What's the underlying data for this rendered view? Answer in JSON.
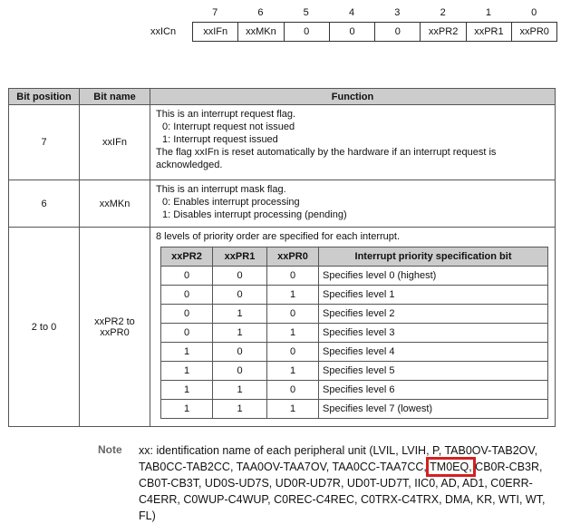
{
  "register": {
    "name": "xxICn",
    "bit_numbers": [
      "7",
      "6",
      "5",
      "4",
      "3",
      "2",
      "1",
      "0"
    ],
    "bits": [
      "xxIFn",
      "xxMKn",
      "0",
      "0",
      "0",
      "xxPR2",
      "xxPR1",
      "xxPR0"
    ]
  },
  "table": {
    "headers": [
      "Bit position",
      "Bit name",
      "Function"
    ],
    "rows": [
      {
        "position": "7",
        "name": "xxIFn",
        "lines": [
          "This is an interrupt request flag.",
          "0: Interrupt request not issued",
          "1: Interrupt request issued",
          "The flag xxIFn is reset automatically by the hardware if an interrupt request is acknowledged."
        ]
      },
      {
        "position": "6",
        "name": "xxMKn",
        "lines": [
          "This is an interrupt mask flag.",
          "0: Enables interrupt processing",
          "1: Disables interrupt processing (pending)"
        ]
      },
      {
        "position": "2 to 0",
        "name": "xxPR2 to xxPR0",
        "intro": "8 levels of priority order are specified for each interrupt."
      }
    ],
    "priority": {
      "headers": [
        "xxPR2",
        "xxPR1",
        "xxPR0",
        "Interrupt priority specification bit"
      ],
      "rows": [
        [
          "0",
          "0",
          "0",
          "Specifies level 0 (highest)"
        ],
        [
          "0",
          "0",
          "1",
          "Specifies level 1"
        ],
        [
          "0",
          "1",
          "0",
          "Specifies level 2"
        ],
        [
          "0",
          "1",
          "1",
          "Specifies level 3"
        ],
        [
          "1",
          "0",
          "0",
          "Specifies level 4"
        ],
        [
          "1",
          "0",
          "1",
          "Specifies level 5"
        ],
        [
          "1",
          "1",
          "0",
          "Specifies level 6"
        ],
        [
          "1",
          "1",
          "1",
          "Specifies level 7 (lowest)"
        ]
      ]
    }
  },
  "note": {
    "label": "Note",
    "before": "xx: identification name of each peripheral unit (LVIL, LVIH, P, TAB0OV-TAB2OV, TAB0CC-TAB2CC, TAA0OV-TAA7OV, TAA0CC-TAA7CC, ",
    "highlight": "TM0EQ,",
    "after": " CB0R-CB3R, CB0T-CB3T, UD0S-UD7S, UD0R-UD7R, UD0T-UD7T, IIC0, AD, AD1, C0ERR-C4ERR, C0WUP-C4WUP, C0REC-C4REC, C0TRX-C4TRX, DMA, KR, WTI, WT, FL)",
    "highlight_color": "#d42020"
  }
}
